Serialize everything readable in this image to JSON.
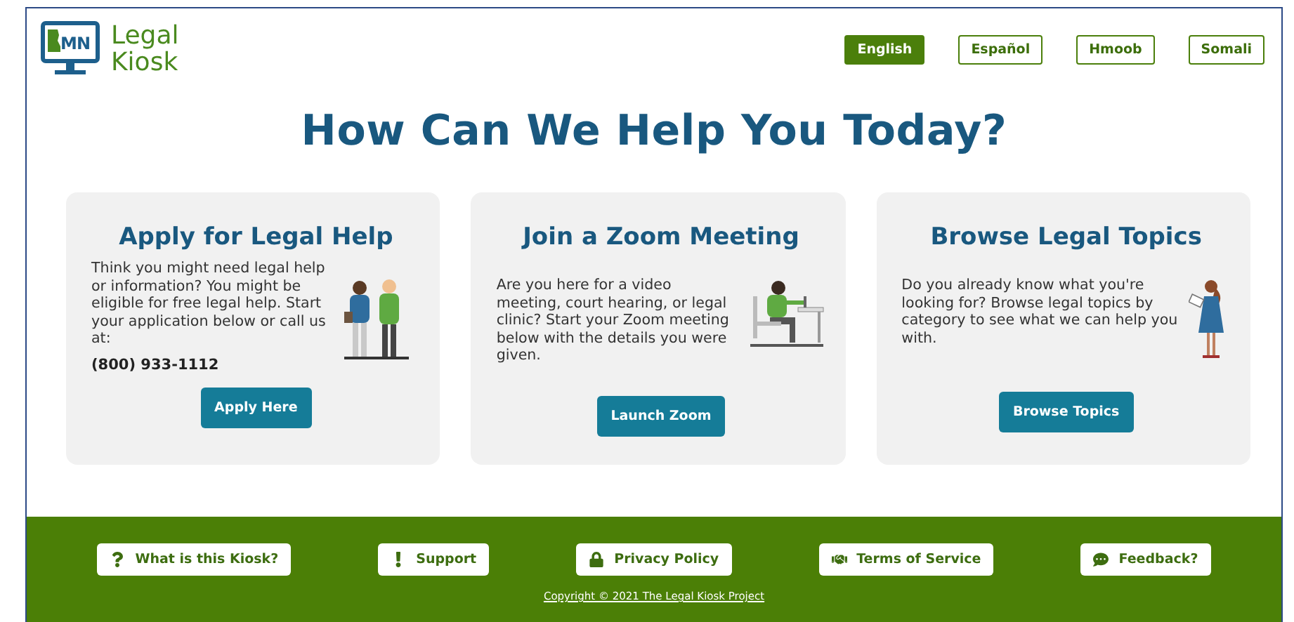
{
  "logo": {
    "badge": "MN",
    "name_line_1": "Legal",
    "name_line_2": "Kiosk"
  },
  "languages": [
    {
      "label": "English",
      "selected": true
    },
    {
      "label": "Español",
      "selected": false
    },
    {
      "label": "Hmoob",
      "selected": false
    },
    {
      "label": "Somali",
      "selected": false
    }
  ],
  "heading": "How Can We Help You Today?",
  "cards": [
    {
      "kind": "people",
      "title": "Apply for Legal Help",
      "body": "Think you might need legal help or information? You might be eligible for free legal help. Start your application below or call us at:",
      "phone": "(800) 933-1112",
      "button": "Apply Here"
    },
    {
      "kind": "desk",
      "title": "Join a Zoom Meeting",
      "body": "Are you here for a video meeting, court hearing, or legal clinic? Start your Zoom meeting below with the details you were given.",
      "button": "Launch Zoom"
    },
    {
      "kind": "reader",
      "title": "Browse Legal Topics",
      "body": "Do you already know what you're looking for? Browse legal topics by category to see what we can help you with.",
      "button": "Browse Topics"
    }
  ],
  "footer_links": [
    {
      "kind": "question",
      "label": "What is this Kiosk?"
    },
    {
      "kind": "alert",
      "label": "Support"
    },
    {
      "kind": "lock",
      "label": "Privacy Policy"
    },
    {
      "kind": "handshake",
      "label": "Terms of Service"
    },
    {
      "kind": "chat",
      "label": "Feedback?"
    }
  ],
  "copyright": "Copyright © 2021 The Legal Kiosk Project"
}
